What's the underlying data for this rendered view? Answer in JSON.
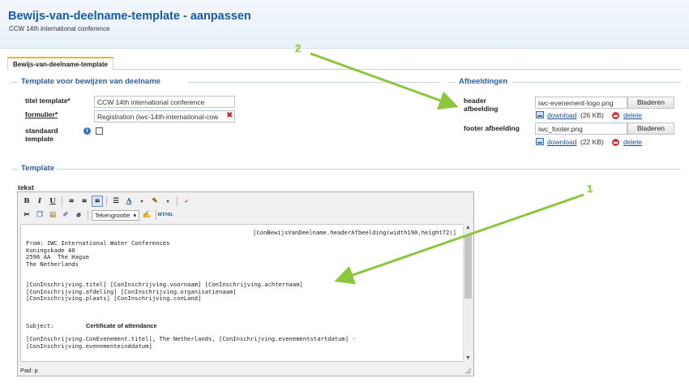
{
  "header": {
    "title": "Bewijs-van-deelname-template - aanpassen",
    "subtitle": "CCW 14th international conference"
  },
  "tab": {
    "label": "Bewijs-van-deelname-template"
  },
  "template_section": {
    "title": "Template voor bewijzen van deelname",
    "titel_label": "titel template*",
    "titel_value": "CCW 14th international conference",
    "formulier_label": "formulier*",
    "formulier_value": "Registration (iwc-14th-international-cow",
    "standaard_label": "standaard template"
  },
  "images_section": {
    "title": "Afbeeldingen",
    "header_label": "header afbeelding",
    "header_file": "iwc-evenement-logo.png",
    "header_download": "download",
    "header_size": "(26 KB)",
    "footer_label": "footer afbeelding",
    "footer_file": "iwc_footer.png",
    "footer_download": "download",
    "footer_size": "(22 KB)",
    "browse_label": "Bladeren",
    "delete_label": "delete"
  },
  "editor_section": {
    "title": "Template",
    "field_label": "tekst",
    "font_size_label": "Tekengrootte",
    "status": "Pad: p",
    "lines": {
      "header_field": "[ConBewijsVanDeelname.headerAfbeelding(width190,height72)]",
      "from": "From: IWC International Water Conferences",
      "addr1": "Koningskade 40",
      "addr2": "2596 AA  The Hague",
      "addr3": "The Netherlands",
      "rec1": "[ConInschrijving.titel] [ConInschrijving.voornaam] [ConInschrijving.achternaam]",
      "rec2": "[ConInschrijving.afdeling] [ConInschrijving.organisatienaam]",
      "rec3": "[ConInschrijving.plaats] [ConInschrijving.conLand]",
      "subject_label": "Subject:",
      "subject_value": "Certificate of attendance",
      "event1": "[ConInschrijving.ConEvenement.titel], The Netherlands, [ConInschrijving.evenementstartdatum] -",
      "event2": "[ConInschrijving.evenementeinddatum]"
    }
  },
  "annotations": {
    "one": "1",
    "two": "2"
  },
  "colors": {
    "title": "#1a5aa0",
    "section": "#2b5f9e",
    "arrow": "#8cc63f"
  }
}
